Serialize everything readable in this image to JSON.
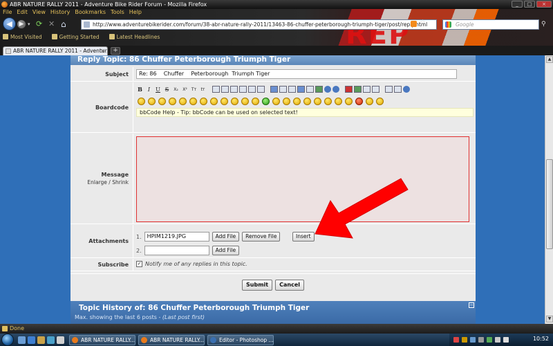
{
  "window": {
    "title": "ABR NATURE RALLY 2011 - Adventure Bike Rider Forum - Mozilla Firefox"
  },
  "menu": [
    "File",
    "Edit",
    "View",
    "History",
    "Bookmarks",
    "Tools",
    "Help"
  ],
  "nav": {
    "url": "http://www.adventurebikerider.com/forum/38-abr-nature-rally-2011/13463-86-chuffer-peterborough-triumph-tiger/post/reply.html",
    "search_placeholder": "Google"
  },
  "bookmarks": [
    "Most Visited",
    "Getting Started",
    "Latest Headlines"
  ],
  "tab": {
    "label": "ABR NATURE RALLY 2011 - Adventur..."
  },
  "reply": {
    "header": "Reply Topic: 86 Chuffer Peterborough Triumph Tiger",
    "subject_label": "Subject",
    "subject_value": "Re: 86    Chuffer    Peterborough  Triumph Tiger",
    "boardcode_label": "Boardcode",
    "bbcode_help": "bbCode Help - Tip: bbCode can be used on selected text!",
    "message_label": "Message",
    "enlarge_label": "Enlarge /  Shrink",
    "attachments_label": "Attachments",
    "attachments": [
      {
        "num": "1.",
        "file": "HPIM1219.JPG",
        "add": "Add File",
        "remove": "Remove File",
        "insert": "Insert"
      },
      {
        "num": "2.",
        "file": "",
        "add": "Add File"
      }
    ],
    "subscribe_label": "Subscribe",
    "subscribe_text": "Notify me of any replies in this topic.",
    "submit": "Submit",
    "cancel": "Cancel"
  },
  "history": {
    "title": "Topic History of: 86 Chuffer Peterborough Triumph Tiger",
    "sub": "Max. showing the last 6 posts - ",
    "sub_italic": "(Last post first)"
  },
  "status": {
    "text": "Done"
  },
  "taskbar": {
    "tasks": [
      "ABR NATURE RALLY...",
      "ABR NATURE RALLY...",
      "Editor - Photoshop ..."
    ],
    "clock": "10:52"
  }
}
